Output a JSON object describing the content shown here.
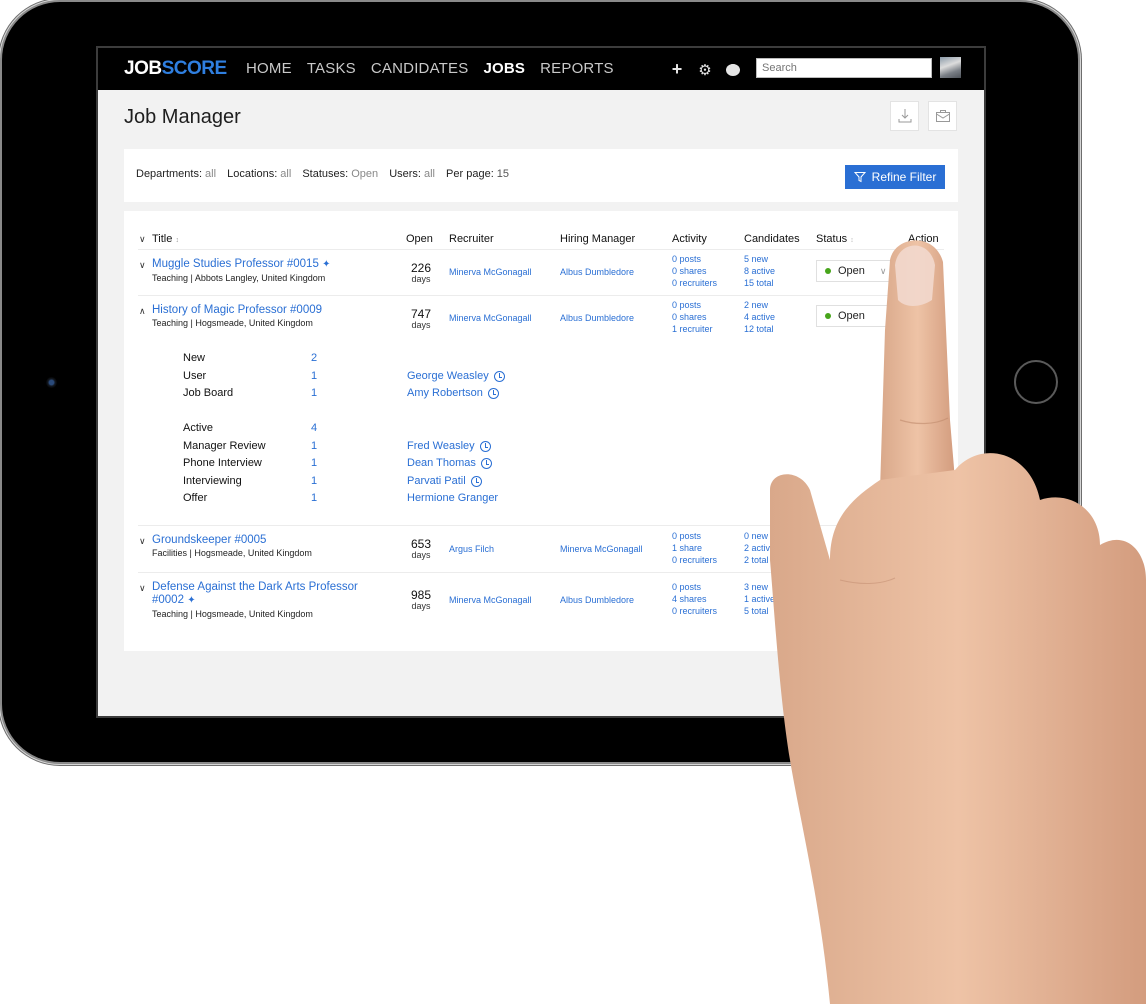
{
  "nav": {
    "logo_part1": "JOB",
    "logo_part2": "SCORE",
    "items": [
      {
        "label": "HOME",
        "active": false
      },
      {
        "label": "TASKS",
        "active": false
      },
      {
        "label": "CANDIDATES",
        "active": false
      },
      {
        "label": "JOBS",
        "active": true
      },
      {
        "label": "REPORTS",
        "active": false
      }
    ],
    "icons": [
      "plus-icon",
      "gear-icon",
      "help-icon"
    ],
    "search_placeholder": "Search"
  },
  "page": {
    "title": "Job Manager",
    "actions": [
      "download-icon",
      "briefcase-icon"
    ]
  },
  "filters": {
    "items": [
      {
        "key": "Departments:",
        "value": "all"
      },
      {
        "key": "Locations:",
        "value": "all"
      },
      {
        "key": "Statuses:",
        "value": "Open"
      },
      {
        "key": "Users:",
        "value": "all"
      },
      {
        "key": "Per page:",
        "value": "15"
      }
    ],
    "refine_label": "Refine Filter"
  },
  "table": {
    "headers": {
      "title": "Title",
      "open": "Open",
      "recruiter": "Recruiter",
      "hiring_manager": "Hiring Manager",
      "activity": "Activity",
      "candidates": "Candidates",
      "status": "Status",
      "action": "Action"
    },
    "rows": [
      {
        "title": "Muggle Studies Professor #0015",
        "pinned": true,
        "expanded": false,
        "subtitle": "Teaching | Abbots Langley, United Kingdom",
        "open_days": "226",
        "days_label": "days",
        "recruiter": "Minerva McGonagall",
        "hiring_manager": "Albus Dumbledore",
        "activity": [
          "0 posts",
          "0 shares",
          "0 recruiters"
        ],
        "candidates": [
          "5 new",
          "8 active",
          "15 total"
        ],
        "status": "Open"
      },
      {
        "title": "History of Magic Professor #0009",
        "pinned": false,
        "expanded": true,
        "subtitle": "Teaching | Hogsmeade, United Kingdom",
        "open_days": "747",
        "days_label": "days",
        "recruiter": "Minerva McGonagall",
        "hiring_manager": "Albus Dumbledore",
        "activity": [
          "0 posts",
          "0 shares",
          "1 recruiter"
        ],
        "candidates": [
          "2 new",
          "4 active",
          "12 total"
        ],
        "status": "Open"
      },
      {
        "title": "Groundskeeper #0005",
        "pinned": false,
        "expanded": false,
        "subtitle": "Facilities | Hogsmeade, United Kingdom",
        "open_days": "653",
        "days_label": "days",
        "recruiter": "Argus Filch",
        "hiring_manager": "Minerva McGonagall",
        "activity": [
          "0 posts",
          "1 share",
          "0 recruiters"
        ],
        "candidates": [
          "0 new",
          "2 active",
          "2 total"
        ],
        "status": ""
      },
      {
        "title_line1": "Defense Against the Dark Arts Professor",
        "title_line2": "#0002",
        "pinned": true,
        "expanded": false,
        "subtitle": "Teaching | Hogsmeade, United Kingdom",
        "open_days": "985",
        "days_label": "days",
        "recruiter": "Minerva McGonagall",
        "hiring_manager": "Albus Dumbledore",
        "activity": [
          "0 posts",
          "4 shares",
          "0 recruiters"
        ],
        "candidates": [
          "3 new",
          "1 active",
          "5 total"
        ],
        "status": ""
      }
    ],
    "expanded_detail": {
      "groups": [
        {
          "label": "New",
          "count": "2",
          "stages": [
            {
              "label": "User",
              "count": "1",
              "candidate": "George Weasley",
              "clock": true
            },
            {
              "label": "Job Board",
              "count": "1",
              "candidate": "Amy Robertson",
              "clock": true
            }
          ]
        },
        {
          "label": "Active",
          "count": "4",
          "stages": [
            {
              "label": "Manager Review",
              "count": "1",
              "candidate": "Fred Weasley",
              "clock": true
            },
            {
              "label": "Phone Interview",
              "count": "1",
              "candidate": "Dean Thomas",
              "clock": true
            },
            {
              "label": "Interviewing",
              "count": "1",
              "candidate": "Parvati Patil",
              "clock": true
            },
            {
              "label": "Offer",
              "count": "1",
              "candidate": "Hermione Granger",
              "clock": false
            }
          ]
        }
      ]
    }
  },
  "colors": {
    "accent": "#2a6fd4",
    "logo_blue": "#2f7fe0",
    "status_open": "#47a51b",
    "nav_bg": "#000000",
    "page_bg": "#f2f2f2"
  }
}
